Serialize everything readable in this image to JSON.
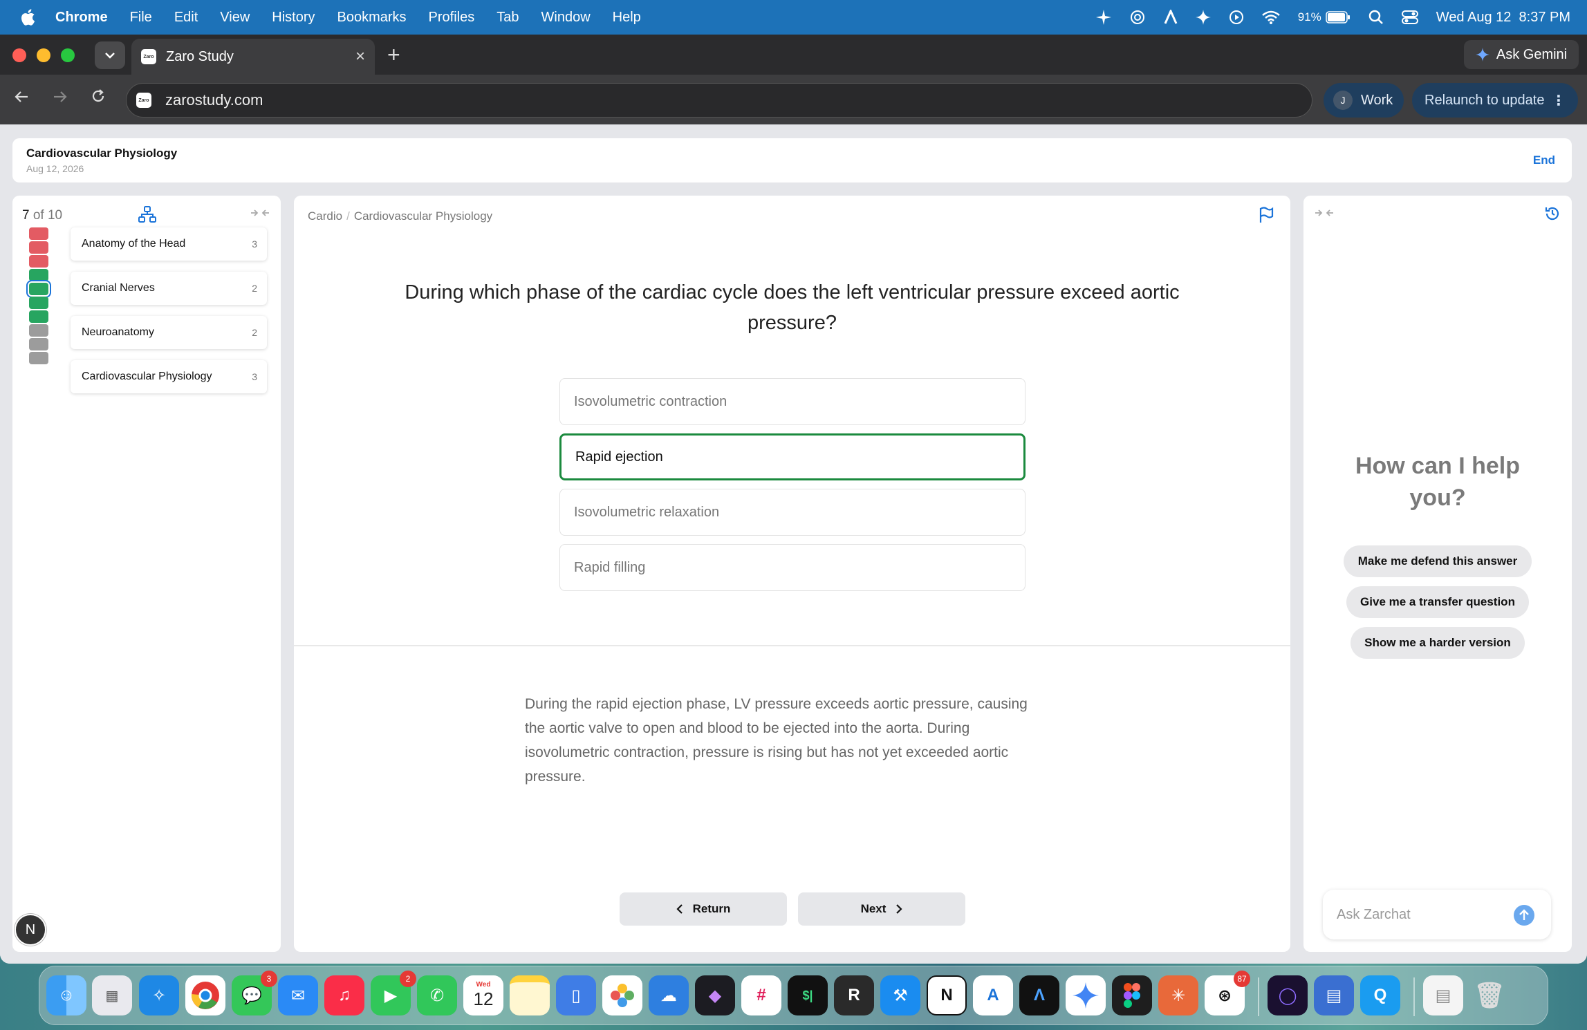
{
  "menubar": {
    "items": [
      "Chrome",
      "File",
      "Edit",
      "View",
      "History",
      "Bookmarks",
      "Profiles",
      "Tab",
      "Window",
      "Help"
    ],
    "battery": "91%",
    "clock": "Wed Aug 12  8:37 PM"
  },
  "browser": {
    "tab_title": "Zaro Study",
    "favicon_text": "Zaro",
    "url": "zarostudy.com",
    "ask_gemini": "Ask Gemini",
    "profile_initial": "J",
    "profile_label": "Work",
    "relaunch_label": "Relaunch to update"
  },
  "session": {
    "title": "Cardiovascular Physiology",
    "date": "Aug 12, 2026",
    "end_label": "End"
  },
  "progress": {
    "current": "7",
    "of_total": " of 10",
    "question_states": [
      "incorrect",
      "incorrect",
      "incorrect",
      "correct",
      "correct",
      "correct",
      "correct",
      "unanswered",
      "unanswered",
      "unanswered"
    ],
    "current_index": 4
  },
  "topics": [
    {
      "name": "Anatomy of the Head",
      "count": "3"
    },
    {
      "name": "Cranial Nerves",
      "count": "2"
    },
    {
      "name": "Neuroanatomy",
      "count": "2"
    },
    {
      "name": "Cardiovascular Physiology",
      "count": "3"
    }
  ],
  "user_initial": "N",
  "breadcrumb": {
    "root": "Cardio",
    "sep": "/",
    "leaf": "Cardiovascular Physiology"
  },
  "question": {
    "text": "During which phase of the cardiac cycle does the left ventricular pressure exceed aortic pressure?",
    "options": [
      "Isovolumetric contraction",
      "Rapid ejection",
      "Isovolumetric relaxation",
      "Rapid filling"
    ],
    "selected_index": 1,
    "explanation": "During the rapid ejection phase, LV pressure exceeds aortic pressure, causing the aortic valve to open and blood to be ejected into the aorta. During isovolumetric contraction, pressure is rising but has not yet exceeded aortic pressure."
  },
  "nav": {
    "return_label": "Return",
    "next_label": "Next"
  },
  "assistant": {
    "heading": "How can I help you?",
    "suggestions": [
      "Make me defend this answer",
      "Give me a transfer question",
      "Show me a harder version"
    ],
    "input_placeholder": "Ask Zarchat"
  },
  "dock": {
    "badges": {
      "messages": "3",
      "facetime": "2",
      "calendar_day": "12",
      "calendar_weekday": "Wed",
      "chatgpt": "87"
    },
    "colors": {
      "menubar": "#1d72b8",
      "accent": "#1a73d9",
      "correct": "#27a560",
      "incorrect": "#e35b63",
      "unanswered": "#9c9c9c"
    }
  }
}
